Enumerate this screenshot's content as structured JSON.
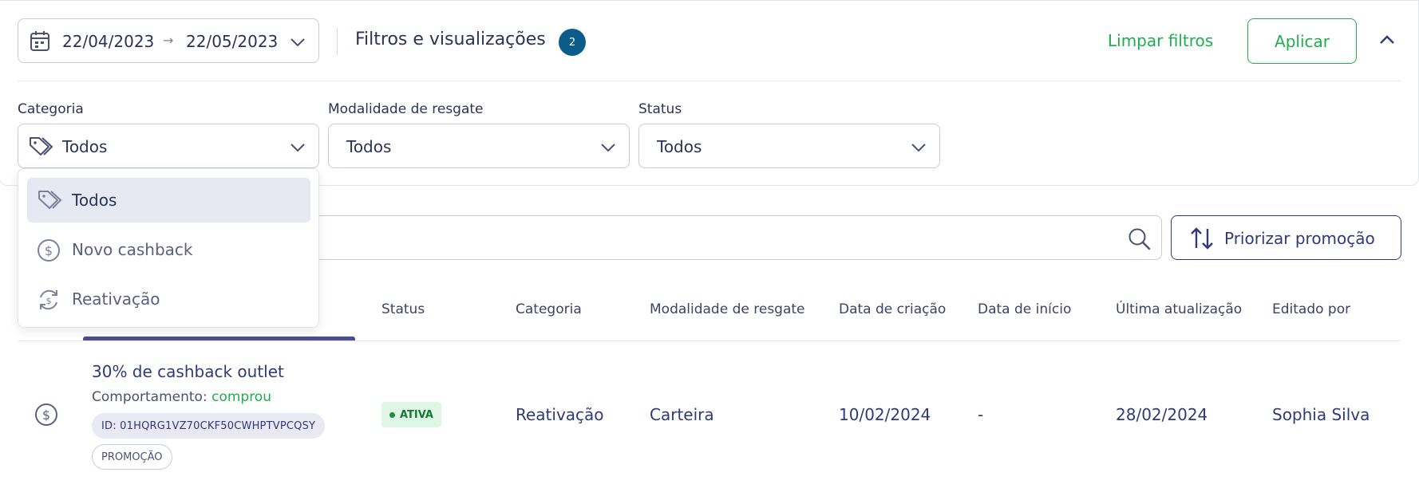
{
  "date_range": {
    "start": "22/04/2023",
    "arrow": "→",
    "end": "22/05/2023"
  },
  "filters": {
    "title": "Filtros e visualizações",
    "count": "2",
    "clear_label": "Limpar filtros",
    "apply_label": "Aplicar",
    "category": {
      "label": "Categoria",
      "value": "Todos"
    },
    "redemption": {
      "label": "Modalidade de resgate",
      "value": "Todos"
    },
    "status": {
      "label": "Status",
      "value": "Todos"
    }
  },
  "category_menu": {
    "items": [
      {
        "label": "Todos",
        "icon": "tag-icon",
        "selected": true
      },
      {
        "label": "Novo cashback",
        "icon": "dollar-circle-icon",
        "selected": false
      },
      {
        "label": "Reativação",
        "icon": "reactivation-icon",
        "selected": false
      }
    ]
  },
  "toolbar": {
    "prioritize_label": "Priorizar promoção"
  },
  "table": {
    "headers": [
      "Status",
      "Categoria",
      "Modalidade de resgate",
      "Data de criação",
      "Data de início",
      "Última atualização",
      "Editado por"
    ],
    "rows": [
      {
        "title": "30% de cashback outlet",
        "behavior_label": "Comportamento:",
        "behavior_value": "comprou",
        "id": "ID: 01HQRG1VZ70CKF50CWHPTVPCQSY",
        "type": "PROMOÇÃO",
        "status": "ATIVA",
        "category": "Reativação",
        "redemption": "Carteira",
        "created": "10/02/2024",
        "start": "-",
        "updated": "28/02/2024",
        "editor": "Sophia Silva"
      }
    ]
  },
  "colors": {
    "accent_green": "#1fae4e",
    "primary_navy": "#2f3a76",
    "badge_blue": "#0b5b8b"
  }
}
